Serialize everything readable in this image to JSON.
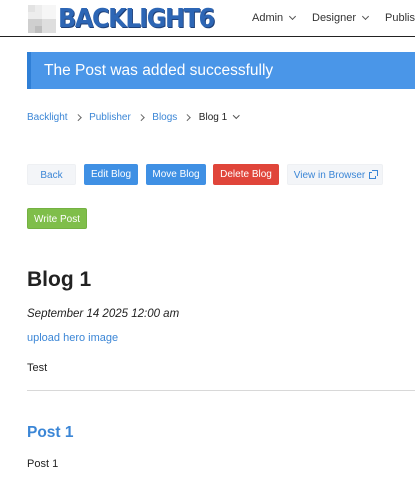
{
  "header": {
    "logo_text": "BACKLIGHT6",
    "nav": [
      {
        "label": "Admin"
      },
      {
        "label": "Designer"
      },
      {
        "label": "Publish"
      }
    ]
  },
  "banner": {
    "message": "The Post was added successfully"
  },
  "breadcrumb": {
    "items": [
      "Backlight",
      "Publisher",
      "Blogs"
    ],
    "current": "Blog 1"
  },
  "toolbar": {
    "back_label": "Back",
    "edit_label": "Edit Blog",
    "move_label": "Move Blog",
    "delete_label": "Delete Blog",
    "view_label": "View in Browser",
    "write_label": "Write Post"
  },
  "blog": {
    "title": "Blog 1",
    "date": "September 14 2025 12:00 am",
    "hero_link": "upload hero image",
    "body": "Test"
  },
  "posts": [
    {
      "title": "Post 1",
      "body": "Post 1"
    }
  ],
  "colors": {
    "accent": "#3f90e4",
    "banner": "#4a96e8",
    "danger": "#e0453a",
    "success": "#7fbe4a",
    "logo": "#2d66b5"
  }
}
